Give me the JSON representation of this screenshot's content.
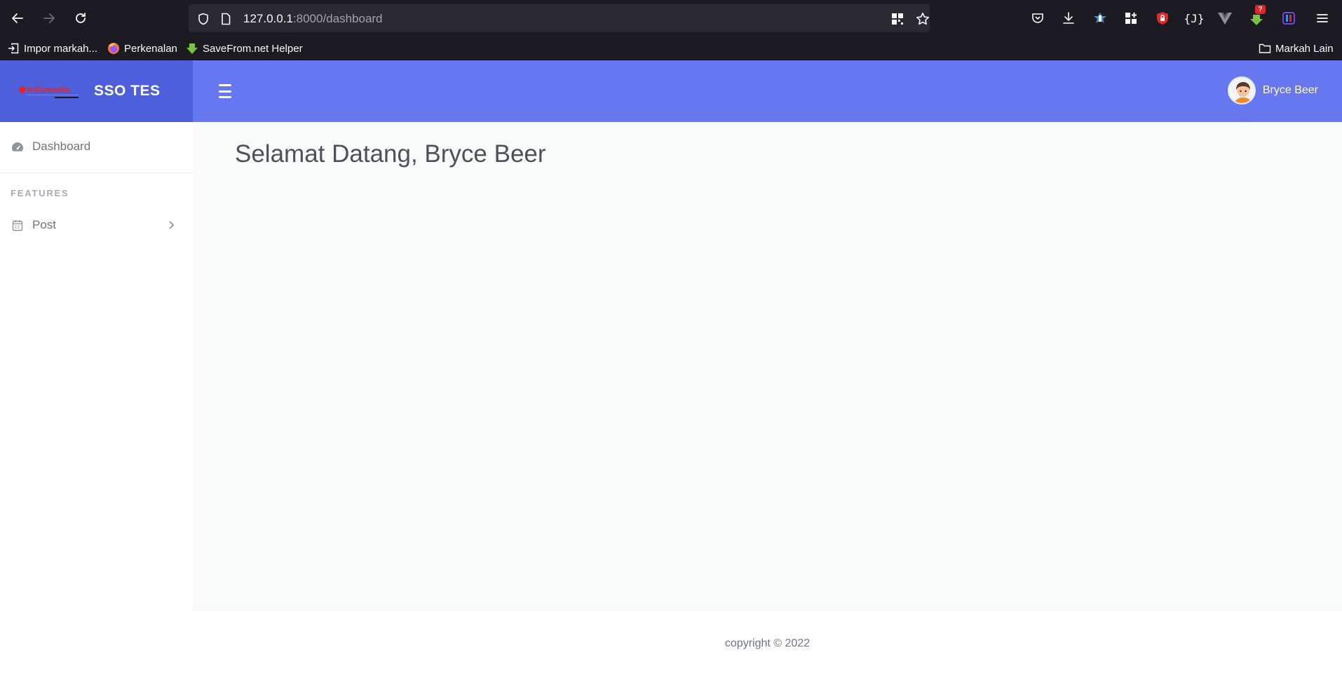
{
  "browser": {
    "url_host": "127.0.0.1",
    "url_path": ":8000/dashboard",
    "bookmarks": [
      {
        "label": "Impor markah...",
        "icon": "import-icon"
      },
      {
        "label": "Perkenalan",
        "icon": "firefox-icon"
      },
      {
        "label": "SaveFrom.net Helper",
        "icon": "download-arrow-icon"
      }
    ],
    "other_bookmarks": "Markah Lain",
    "extension_badge": "?"
  },
  "app": {
    "brand_logo_text": "Infomedia",
    "brand_name": "SSO TES",
    "user_name": "Bryce Beer",
    "accent_color": "#6777ef",
    "brand_bg_color": "#4e5fdc"
  },
  "sidebar": {
    "items": [
      {
        "label": "Dashboard",
        "icon": "dashboard-gauge-icon"
      }
    ],
    "section_header": "FEATURES",
    "feature_items": [
      {
        "label": "Post",
        "icon": "calendar-icon",
        "has_submenu": true
      }
    ]
  },
  "main": {
    "title": "Selamat Datang, Bryce Beer"
  },
  "footer": {
    "copyright": "copyright © 2022"
  }
}
